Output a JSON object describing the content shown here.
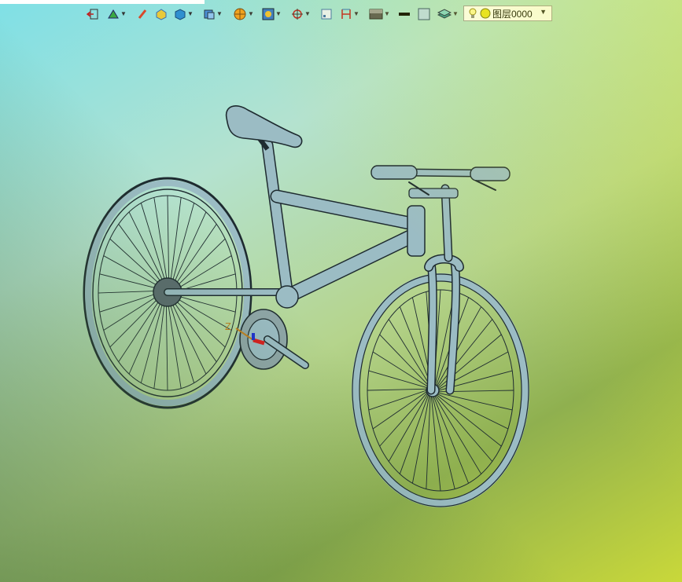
{
  "toolbar": {
    "layer_selector": {
      "value": "图层0000"
    }
  },
  "viewport": {
    "model": "bicycle",
    "axis_label": "Z",
    "colors": {
      "frame": "#9bbcc4",
      "outline": "#1e2b30",
      "axis_z": "#c08020",
      "axis_x": "#d81f1f",
      "axis_y": "#1d2fd0"
    }
  }
}
